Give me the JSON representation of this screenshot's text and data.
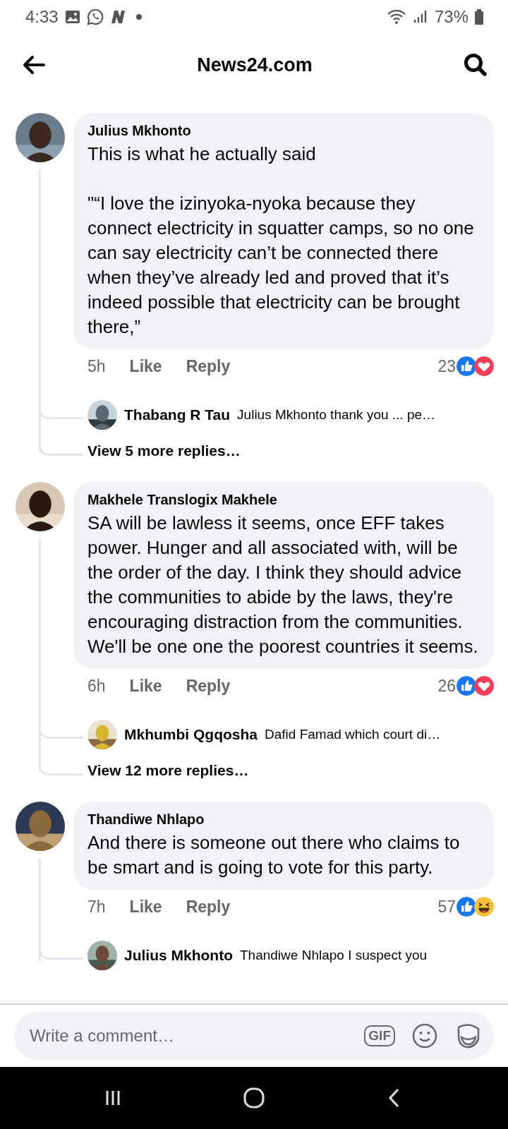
{
  "status_bar": {
    "time": "4:33",
    "battery": "73%"
  },
  "header": {
    "title": "News24.com"
  },
  "comments": [
    {
      "author": "Julius Mkhonto",
      "text": "This is what he actually said\n\n\"“I love the izinyoka-nyoka because they connect electricity in squatter camps, so no one can say electricity can’t be connected there when they’ve already led and proved that it’s indeed possible that electricity can be brought there,”",
      "time": "5h",
      "like": "Like",
      "reply": "Reply",
      "count": "23",
      "reactions": [
        {
          "kind": "like"
        },
        {
          "kind": "love"
        }
      ],
      "replies": [
        {
          "author": "Thabang R Tau",
          "text": "Julius Mkhonto thank you ... pe…"
        }
      ],
      "more": "View 5 more replies…"
    },
    {
      "author": "Makhele Translogix Makhele",
      "text": "SA will be lawless it seems, once EFF takes power. Hunger and all associated with, will be the order of the day. I think they should advice the communities to abide by the laws, they're encouraging distraction from the communities. We'll be one one the poorest countries it seems.",
      "time": "6h",
      "like": "Like",
      "reply": "Reply",
      "count": "26",
      "reactions": [
        {
          "kind": "like"
        },
        {
          "kind": "love"
        }
      ],
      "replies": [
        {
          "author": "Mkhumbi Qgqosha",
          "text": "Dafid Famad which court di…"
        }
      ],
      "more": "View 12 more replies…"
    },
    {
      "author": "Thandiwe Nhlapo",
      "text": "And there is someone out there who claims to be smart and is going to vote for this party.",
      "time": "7h",
      "like": "Like",
      "reply": "Reply",
      "count": "57",
      "reactions": [
        {
          "kind": "like"
        },
        {
          "kind": "haha"
        }
      ],
      "replies": [
        {
          "author": "Julius Mkhonto",
          "text": "Thandiwe Nhlapo I suspect you"
        }
      ]
    }
  ],
  "composer": {
    "placeholder": "Write a comment…",
    "gif": "GIF"
  }
}
